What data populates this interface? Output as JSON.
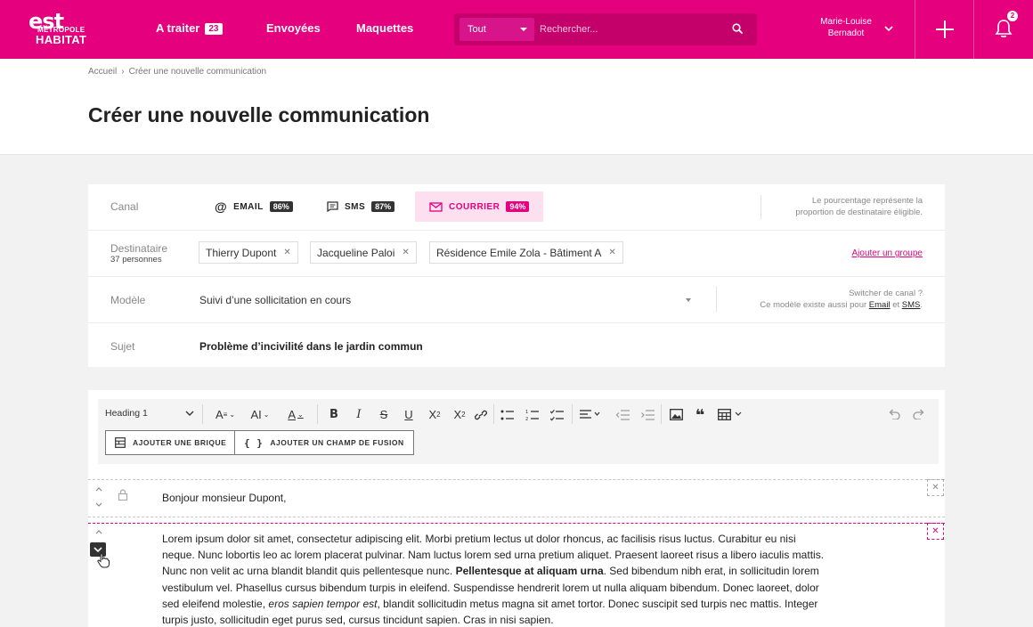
{
  "header": {
    "logo": {
      "line1": "est",
      "line2": "MÉTROPOLE",
      "line3": "HABITAT"
    },
    "nav": [
      {
        "label": "A traiter",
        "badge": "23"
      },
      {
        "label": "Envoyées"
      },
      {
        "label": "Maquettes"
      }
    ],
    "search": {
      "scope": "Tout",
      "placeholder": "Rechercher..."
    },
    "user": {
      "first": "Marie-Louise",
      "last": "Bernadot"
    },
    "notifications": "2",
    "colors": {
      "brand": "#e5007d"
    }
  },
  "breadcrumb": [
    "Accueil",
    "Créer une nouvelle communication"
  ],
  "page_title": "Créer une nouvelle communication",
  "form": {
    "canal": {
      "label": "Canal",
      "options": [
        {
          "name": "EMAIL",
          "pct": "86%"
        },
        {
          "name": "SMS",
          "pct": "87%"
        },
        {
          "name": "COURRIER",
          "pct": "94%"
        }
      ],
      "note_1": "Le pourcentage représente la",
      "note_2": "proportion de destinataire éligible."
    },
    "destinataire": {
      "label": "Destinataire",
      "count": "37 personnes",
      "chips": [
        "Thierry Dupont",
        "Jacqueline Paloi",
        "Résidence Emile Zola - Bâtiment A"
      ],
      "add_group": "Ajouter un groupe"
    },
    "modele": {
      "label": "Modèle",
      "value": "Suivi d’une sollicitation en cours",
      "note_1": "Switcher de canal ?",
      "note_2a": "Ce modèle existe aussi pour ",
      "note_email": "Email",
      "note_et": " et ",
      "note_sms": "SMS",
      "note_end": "."
    },
    "sujet": {
      "label": "Sujet",
      "value": "Problème d’incivilité dans le jardin commun"
    }
  },
  "editor": {
    "style_select": "Heading 1",
    "add_brick": "AJOUTER UNE BRIQUE",
    "add_field": "AJOUTER UN CHAMP DE FUSION",
    "greeting": "Bonjour monsieur Dupont,",
    "paragraph": {
      "p1": "Lorem ipsum dolor sit amet, consectetur adipiscing elit. Morbi pretium lectus ut dolor rhoncus, ac facilisis risus luctus. Curabitur eu nisi neque. Nunc lobortis leo ac lorem placerat pulvinar. Nam luctus lorem sed urna pretium aliquet. Praesent laoreet risus a libero iaculis mattis. Nunc non velit ac urna blandit blandit quis pellentesque nunc. ",
      "bold": "Pellentesque at aliquam urna",
      "p2": ". Sed bibendum nibh erat, in sollicitudin lorem vestibulum vel. Phasellus cursus bibendum turpis in eleifend. Suspendisse hendrerit lorem ut nulla aliquam bibendum. Donec laoreet, dolor sed eleifend molestie, ",
      "italic": "eros sapien tempor est",
      "p3": ", blandit sollicitudin metus magna sit amet tortor. Donec suscipit sed turpis nec mattis. Integer turpis justo, sollicitudin eget purus sed, cursus tincidunt sapien. Cras in nisi sapien."
    }
  }
}
